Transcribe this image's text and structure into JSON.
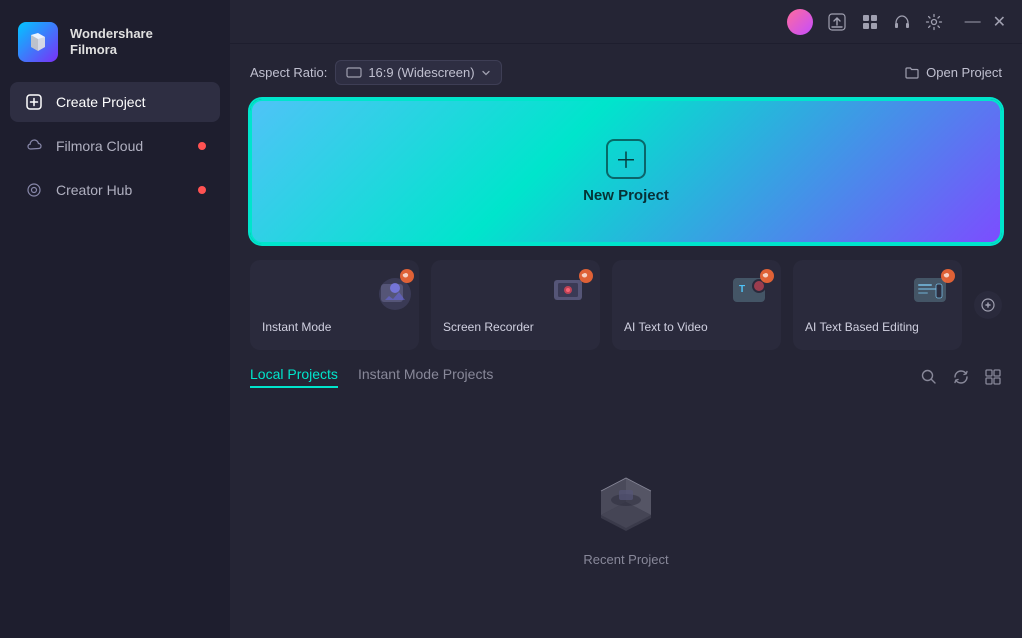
{
  "app": {
    "brand": "Wondershare",
    "product": "Filmora"
  },
  "sidebar": {
    "items": [
      {
        "id": "create-project",
        "label": "Create Project",
        "icon": "➕",
        "active": true,
        "dot": false
      },
      {
        "id": "filmora-cloud",
        "label": "Filmora Cloud",
        "icon": "☁",
        "active": false,
        "dot": true
      },
      {
        "id": "creator-hub",
        "label": "Creator Hub",
        "icon": "◎",
        "active": false,
        "dot": true
      }
    ]
  },
  "titlebar": {
    "icons": [
      "avatar",
      "cloud-upload",
      "grid-apps",
      "headset",
      "settings"
    ],
    "window": {
      "minimize": "—",
      "close": "✕"
    }
  },
  "topbar": {
    "aspect_ratio_label": "Aspect Ratio:",
    "aspect_ratio_value": "16:9 (Widescreen)",
    "open_project_label": "Open Project"
  },
  "new_project": {
    "label": "New Project"
  },
  "feature_cards": [
    {
      "id": "instant-mode",
      "label": "Instant Mode"
    },
    {
      "id": "screen-recorder",
      "label": "Screen Recorder"
    },
    {
      "id": "ai-text-to-video",
      "label": "AI Text to Video"
    },
    {
      "id": "ai-text-based-editing",
      "label": "AI Text Based Editing"
    }
  ],
  "projects": {
    "tabs": [
      {
        "id": "local-projects",
        "label": "Local Projects",
        "active": true
      },
      {
        "id": "instant-mode-projects",
        "label": "Instant Mode Projects",
        "active": false
      }
    ],
    "empty_label": "Recent Project"
  }
}
